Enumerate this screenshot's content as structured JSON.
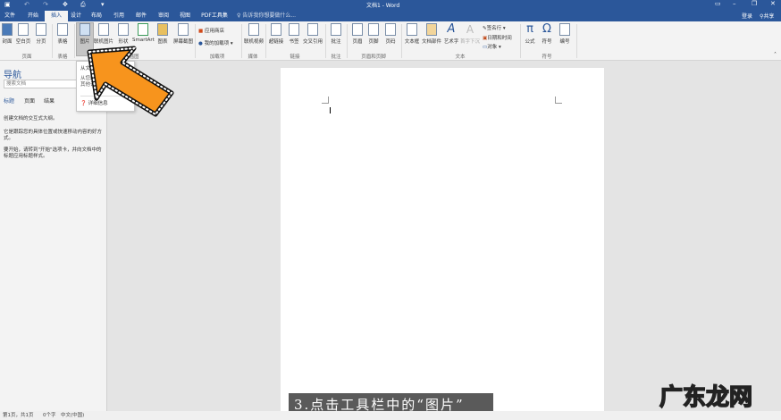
{
  "title": "文档1 - Word",
  "quick_access": [
    "save-icon",
    "undo-icon",
    "redo-icon",
    "touch-mode-icon",
    "print-preview-icon",
    "customize-icon"
  ],
  "window_controls": {
    "login": "登录",
    "share": "共享"
  },
  "tabs": [
    "文件",
    "开始",
    "插入",
    "设计",
    "布局",
    "引用",
    "邮件",
    "审阅",
    "视图",
    "PDF工具集"
  ],
  "active_tab": "插入",
  "tell_me": "告诉我你想要做什么...",
  "ribbon": {
    "buttons": [
      "封面",
      "空白页",
      "分页",
      "表格",
      "图片",
      "联机图片",
      "形状",
      "SmartArt",
      "图表",
      "屏幕截图",
      "联机视频",
      "超链接",
      "书签",
      "交叉引用",
      "批注",
      "页眉",
      "页脚",
      "页码",
      "文本框",
      "文档部件",
      "艺术字",
      "首字下沉",
      "公式",
      "符号",
      "编号"
    ],
    "addins": [
      "应用商店",
      "我的加载项"
    ],
    "text_small": [
      "签名行",
      "日期和时间",
      "对象"
    ],
    "groups": [
      "页面",
      "表格",
      "插图",
      "加载项",
      "媒体",
      "链接",
      "批注",
      "页眉和页脚",
      "文本",
      "符号"
    ]
  },
  "tooltip": {
    "title": "从文件",
    "body": "从您的计…到机其他计…图片。",
    "more": "详细信息"
  },
  "nav": {
    "title": "导航",
    "search_placeholder": "搜索文档",
    "tabs": [
      "标题",
      "页面",
      "结果"
    ],
    "paragraphs": [
      "创建文档的交互式大纲。",
      "它是跟踪您的具体位置或快速移动内容的好方式。",
      "要开始，请转到\"开始\"选项卡，并向文档中的标题应用标题样式。"
    ]
  },
  "status": {
    "page": "第1页，共1页",
    "words": "0个字",
    "lang": "中文(中国)"
  },
  "caption": "3.点击工具栏中的“图片”",
  "watermark": "广东龙网",
  "colors": {
    "title_bar": "#2b579a",
    "arrow": "#f7941d"
  }
}
